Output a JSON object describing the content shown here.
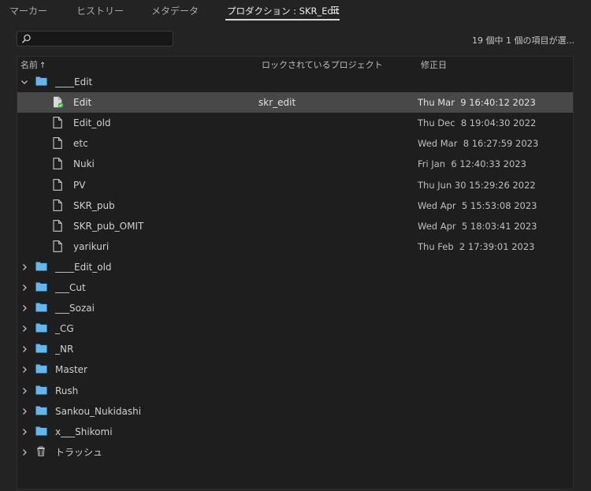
{
  "tabs": [
    {
      "label": "マーカー"
    },
    {
      "label": "ヒストリー"
    },
    {
      "label": "メタデータ"
    },
    {
      "label": "プロダクション : SKR_Edit"
    }
  ],
  "search": {
    "placeholder": ""
  },
  "status": "19 個中 1 個の項目が選...",
  "columns": {
    "name": "名前",
    "locked": "ロックされているプロジェクト",
    "modified": "修正日"
  },
  "root_folder": {
    "name": "____Edit"
  },
  "files": [
    {
      "name": "Edit",
      "locked_by": "skr_edit",
      "modified": "Thu Mar  9 16:40:12 2023"
    },
    {
      "name": "Edit_old",
      "locked_by": "",
      "modified": "Thu Dec  8 19:04:30 2022"
    },
    {
      "name": "etc",
      "locked_by": "",
      "modified": "Wed Mar  8 16:27:59 2023"
    },
    {
      "name": "Nuki",
      "locked_by": "",
      "modified": "Fri Jan  6 12:40:33 2023"
    },
    {
      "name": "PV",
      "locked_by": "",
      "modified": "Thu Jun 30 15:29:26 2022"
    },
    {
      "name": "SKR_pub",
      "locked_by": "",
      "modified": "Wed Apr  5 15:53:08 2023"
    },
    {
      "name": "SKR_pub_OMIT",
      "locked_by": "",
      "modified": "Wed Apr  5 18:03:41 2023"
    },
    {
      "name": "yarikuri",
      "locked_by": "",
      "modified": "Thu Feb  2 17:39:01 2023"
    }
  ],
  "folders": [
    {
      "name": "____Edit_old"
    },
    {
      "name": "___Cut"
    },
    {
      "name": "___Sozai"
    },
    {
      "name": "_CG"
    },
    {
      "name": "_NR"
    },
    {
      "name": "Master"
    },
    {
      "name": "Rush"
    },
    {
      "name": "Sankou_Nukidashi"
    },
    {
      "name": "x___Shikomi"
    }
  ],
  "trash": {
    "label": "トラッシュ"
  },
  "colors": {
    "folder": "#5fb8f0",
    "selected_row": "#484848",
    "background": "#232323",
    "locked_badge": "#3bb54a"
  }
}
